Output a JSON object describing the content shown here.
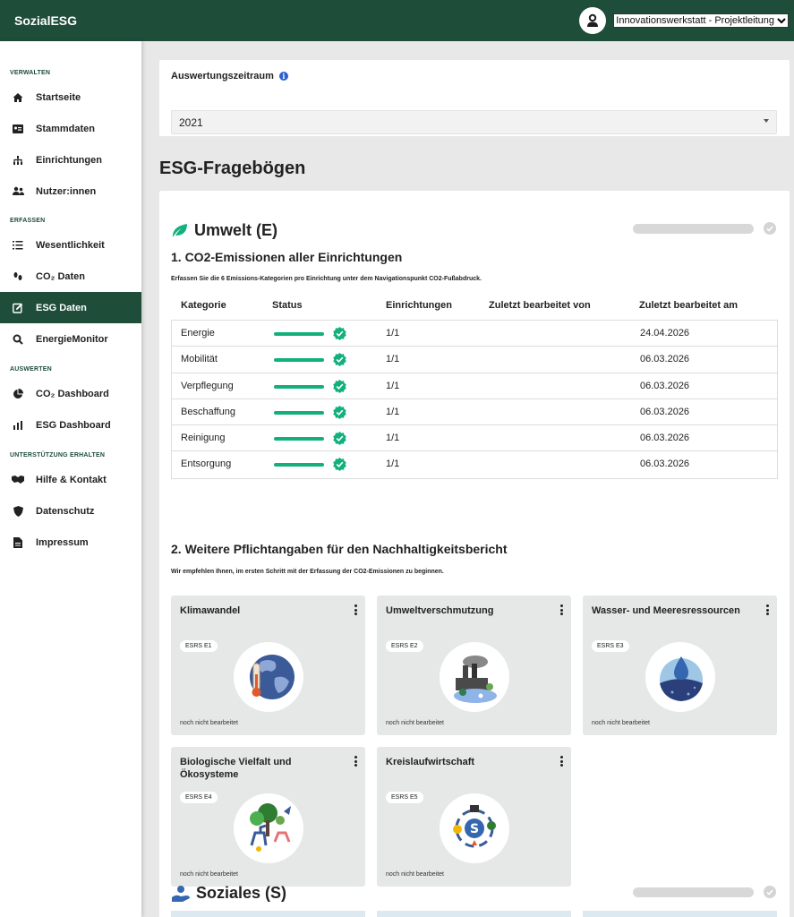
{
  "header": {
    "brand": "SozialESG",
    "organization_select": "Innovationswerkstatt - Projektleitung"
  },
  "sidebar": {
    "sections": [
      {
        "title": "VERWALTEN",
        "items": [
          {
            "label": "Startseite",
            "icon": "home-icon"
          },
          {
            "label": "Stammdaten",
            "icon": "id-card-icon"
          },
          {
            "label": "Einrichtungen",
            "icon": "sitemap-icon"
          },
          {
            "label": "Nutzer:innen",
            "icon": "users-icon"
          }
        ]
      },
      {
        "title": "ERFASSEN",
        "items": [
          {
            "label": "Wesentlichkeit",
            "icon": "list-icon"
          },
          {
            "label": "CO₂ Daten",
            "icon": "footprints-icon"
          },
          {
            "label": "ESG Daten",
            "icon": "edit-icon",
            "active": true
          },
          {
            "label": "EnergieMonitor",
            "icon": "magnifier-icon"
          }
        ]
      },
      {
        "title": "AUSWERTEN",
        "items": [
          {
            "label": "CO₂ Dashboard",
            "icon": "pie-chart-icon"
          },
          {
            "label": "ESG Dashboard",
            "icon": "bar-chart-icon"
          }
        ]
      },
      {
        "title": "UNTERSTÜTZUNG ERHALTEN",
        "items": [
          {
            "label": "Hilfe & Kontakt",
            "icon": "handshake-icon"
          },
          {
            "label": "Datenschutz",
            "icon": "shield-icon"
          },
          {
            "label": "Impressum",
            "icon": "document-icon"
          }
        ]
      }
    ]
  },
  "period": {
    "label": "Auswertungszeitraum",
    "info_icon": "i",
    "value": "2021"
  },
  "page_title": "ESG-Fragebögen",
  "environment": {
    "title": "Umwelt (E)",
    "co2": {
      "title": "1. CO2-Emissionen aller Einrichtungen",
      "hint": "Erfassen Sie die 6 Emissions-Kategorien pro Einrichtung unter dem Navigationspunkt CO2-Fußabdruck.",
      "columns": [
        "Kategorie",
        "Status",
        "Einrichtungen",
        "Zuletzt bearbeitet von",
        "Zuletzt bearbeitet am"
      ],
      "rows": [
        {
          "kategorie": "Energie",
          "status": 1.0,
          "einrichtungen": "1/1",
          "von": "",
          "am": "24.04.2026"
        },
        {
          "kategorie": "Mobilität",
          "status": 1.0,
          "einrichtungen": "1/1",
          "von": "",
          "am": "06.03.2026"
        },
        {
          "kategorie": "Verpflegung",
          "status": 1.0,
          "einrichtungen": "1/1",
          "von": "",
          "am": "06.03.2026"
        },
        {
          "kategorie": "Beschaffung",
          "status": 1.0,
          "einrichtungen": "1/1",
          "von": "",
          "am": "06.03.2026"
        },
        {
          "kategorie": "Reinigung",
          "status": 1.0,
          "einrichtungen": "1/1",
          "von": "",
          "am": "06.03.2026"
        },
        {
          "kategorie": "Entsorgung",
          "status": 1.0,
          "einrichtungen": "1/1",
          "von": "",
          "am": "06.03.2026"
        }
      ]
    },
    "further": {
      "title": "2. Weitere Pflichtangaben für den Nachhaltigkeitsbericht",
      "hint": "Wir empfehlen Ihnen, im ersten Schritt mit der Erfassung der CO2-Emissionen zu beginnen.",
      "tiles": [
        {
          "title": "Klimawandel",
          "badge": "ESRS E1",
          "status": "noch nicht bearbeitet",
          "icon": "globe-thermometer-icon"
        },
        {
          "title": "Umweltverschmutzung",
          "badge": "ESRS E2",
          "status": "noch nicht bearbeitet",
          "icon": "factory-pollution-icon"
        },
        {
          "title": "Wasser- und Meeresressourcen",
          "badge": "ESRS E3",
          "status": "noch nicht bearbeitet",
          "icon": "water-drop-icon"
        },
        {
          "title": "Biologische Vielfalt und Ökosysteme",
          "badge": "ESRS E4",
          "status": "noch nicht bearbeitet",
          "icon": "wildlife-icon"
        },
        {
          "title": "Kreislaufwirtschaft",
          "badge": "ESRS E5",
          "status": "noch nicht bearbeitet",
          "icon": "recycle-cycle-icon"
        }
      ]
    }
  },
  "social": {
    "title": "Soziales (S)"
  },
  "colors": {
    "primary": "#1e4d3a",
    "success": "#13b07e",
    "tile_bg": "#e5e8e7"
  }
}
